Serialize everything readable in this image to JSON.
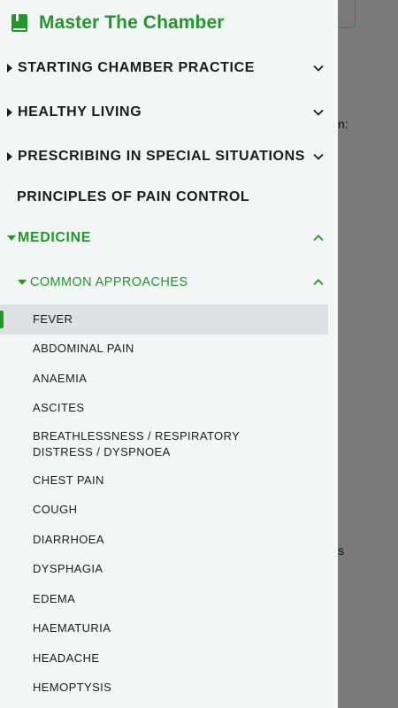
{
  "background": {
    "fragment_1": "n:",
    "fragment_2": "s"
  },
  "drawer": {
    "app_title": "Master The Chamber",
    "sections": [
      {
        "label": "STARTING CHAMBER PRACTICE",
        "expanded": false
      },
      {
        "label": "HEALTHY LIVING",
        "expanded": false
      },
      {
        "label": "PRESCRIBING IN SPECIAL SITUATIONS",
        "expanded": false
      },
      {
        "label": "PRINCIPLES OF PAIN CONTROL"
      },
      {
        "label": "MEDICINE",
        "expanded": true
      }
    ],
    "subsection": {
      "label": "COMMON APPROACHES",
      "expanded": true
    },
    "items": [
      "FEVER",
      "ABDOMINAL PAIN",
      "ANAEMIA",
      "ASCITES",
      "BREATHLESSNESS / RESPIRATORY DISTRESS / DYSPNOEA",
      "CHEST PAIN",
      "COUGH",
      "DIARRHOEA",
      "DYSPHAGIA",
      "EDEMA",
      "HAEMATURIA",
      "HEADACHE",
      "HEMOPTYSIS"
    ],
    "active_item": "FEVER"
  },
  "colors": {
    "accent": "#1f9a2a",
    "drawer_bg": "#f2f6f5",
    "overlay": "#7a7a7a",
    "active_bg": "#dde1e2"
  }
}
